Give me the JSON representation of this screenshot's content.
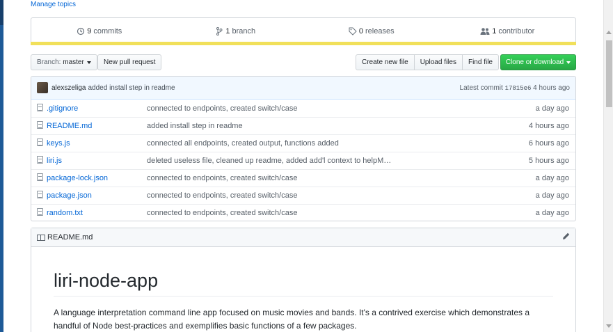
{
  "manage_topics": "Manage topics",
  "summary": {
    "commits": "9",
    "commits_label": "commits",
    "branches": "1",
    "branches_label": "branch",
    "releases": "0",
    "releases_label": "releases",
    "contributors": "1",
    "contributors_label": "contributor",
    "language_color": "#f1e05a"
  },
  "toolbar": {
    "branch_prefix": "Branch:",
    "branch_name": "master",
    "new_pull_request": "New pull request",
    "create_new_file": "Create new file",
    "upload_files": "Upload files",
    "find_file": "Find file",
    "clone_or_download": "Clone or download"
  },
  "commit_tease": {
    "author": "alexszeliga",
    "message": "added install step in readme",
    "latest_label": "Latest commit",
    "sha": "17815e6",
    "age": "4 hours ago"
  },
  "files": [
    {
      "name": ".gitignore",
      "message": "connected to endpoints, created switch/case",
      "age": "a day ago"
    },
    {
      "name": "README.md",
      "message": "added install step in readme",
      "age": "4 hours ago"
    },
    {
      "name": "keys.js",
      "message": "connected all endpoints, created output, functions added",
      "age": "6 hours ago"
    },
    {
      "name": "liri.js",
      "message": "deleted useless file, cleaned up readme, added add'l context to helpM…",
      "age": "5 hours ago"
    },
    {
      "name": "package-lock.json",
      "message": "connected to endpoints, created switch/case",
      "age": "a day ago"
    },
    {
      "name": "package.json",
      "message": "connected to endpoints, created switch/case",
      "age": "a day ago"
    },
    {
      "name": "random.txt",
      "message": "connected to endpoints, created switch/case",
      "age": "a day ago"
    }
  ],
  "readme": {
    "filename": "README.md",
    "title": "liri-node-app",
    "paragraph": "A language interpretation command line app focused on music movies and bands. It's a contrived exercise which demonstrates a handful of Node best-practices and exemplifies basic functions of a few packages."
  },
  "icons": [
    "history-icon",
    "branch-icon",
    "tag-icon",
    "people-icon",
    "file-icon",
    "book-icon",
    "pencil-icon"
  ]
}
